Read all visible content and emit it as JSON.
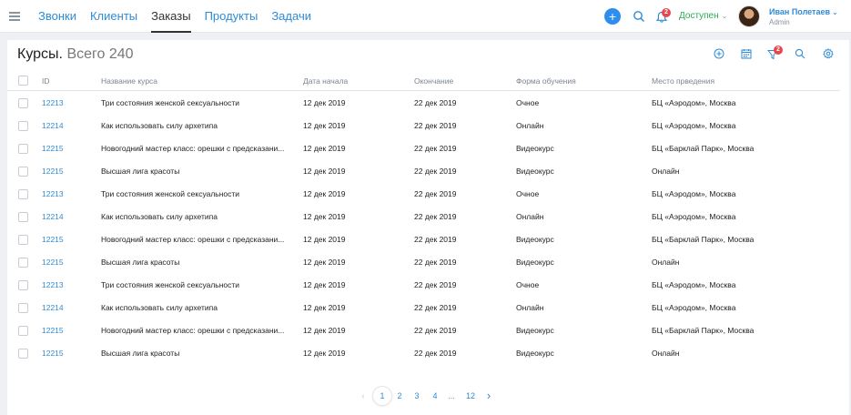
{
  "nav": {
    "items": [
      {
        "label": "Звонки",
        "active": false
      },
      {
        "label": "Клиенты",
        "active": false
      },
      {
        "label": "Заказы",
        "active": true
      },
      {
        "label": "Продукты",
        "active": false
      },
      {
        "label": "Задачи",
        "active": false
      }
    ]
  },
  "header": {
    "add_label": "+",
    "notifications_count": "2",
    "status": "Доступен",
    "user_name": "Иван Полетаев",
    "user_role": "Admin"
  },
  "page": {
    "title": "Курсы.",
    "total": "Всего 240",
    "filter_count": "2"
  },
  "table": {
    "columns": [
      "ID",
      "Название курса",
      "Дата начала",
      "Окончание",
      "Форма обучения",
      "Место прведения"
    ],
    "rows": [
      [
        "12213",
        "Три состояния женской сексуальности",
        "12 дек 2019",
        "22 дек 2019",
        "Очное",
        "БЦ «Аэродом», Москва"
      ],
      [
        "12214",
        "Как использовать силу архетипа",
        "12 дек 2019",
        "22 дек 2019",
        "Онлайн",
        "БЦ «Аэродом», Москва"
      ],
      [
        "12215",
        "Новогодний мастер класс: орешки с предсказани...",
        "12 дек 2019",
        "22 дек 2019",
        "Видеокурс",
        "БЦ «Барклай Парк», Москва"
      ],
      [
        "12215",
        "Высшая лига красоты",
        "12 дек 2019",
        "22 дек 2019",
        "Видеокурс",
        "Онлайн"
      ],
      [
        "12213",
        "Три состояния женской сексуальности",
        "12 дек 2019",
        "22 дек 2019",
        "Очное",
        "БЦ «Аэродом», Москва"
      ],
      [
        "12214",
        "Как использовать силу архетипа",
        "12 дек 2019",
        "22 дек 2019",
        "Онлайн",
        "БЦ «Аэродом», Москва"
      ],
      [
        "12215",
        "Новогодний мастер класс: орешки с предсказани...",
        "12 дек 2019",
        "22 дек 2019",
        "Видеокурс",
        "БЦ «Барклай Парк», Москва"
      ],
      [
        "12215",
        "Высшая лига красоты",
        "12 дек 2019",
        "22 дек 2019",
        "Видеокурс",
        "Онлайн"
      ],
      [
        "12213",
        "Три состояния женской сексуальности",
        "12 дек 2019",
        "22 дек 2019",
        "Очное",
        "БЦ «Аэродом», Москва"
      ],
      [
        "12214",
        "Как использовать силу архетипа",
        "12 дек 2019",
        "22 дек 2019",
        "Онлайн",
        "БЦ «Аэродом», Москва"
      ],
      [
        "12215",
        "Новогодний мастер класс: орешки с предсказани...",
        "12 дек 2019",
        "22 дек 2019",
        "Видеокурс",
        "БЦ «Барклай Парк», Москва"
      ],
      [
        "12215",
        "Высшая лига красоты",
        "12 дек 2019",
        "22 дек 2019",
        "Видеокурс",
        "Онлайн"
      ]
    ]
  },
  "pagination": {
    "pages": [
      "1",
      "2",
      "3",
      "4",
      "...",
      "12"
    ],
    "current": "1"
  },
  "icons": {
    "menu": "menu-icon",
    "add": "plus-icon",
    "search": "search-icon",
    "bell": "bell-icon",
    "add_course": "plus-circle-icon",
    "calendar": "calendar-icon",
    "filter": "filter-icon",
    "settings": "gear-icon",
    "prev": "chevron-left-icon",
    "next": "chevron-right-icon"
  },
  "colors": {
    "accent": "#2f8bd6",
    "primary_button": "#2d8ef0",
    "status": "#2dab52",
    "badge": "#e8464d"
  }
}
